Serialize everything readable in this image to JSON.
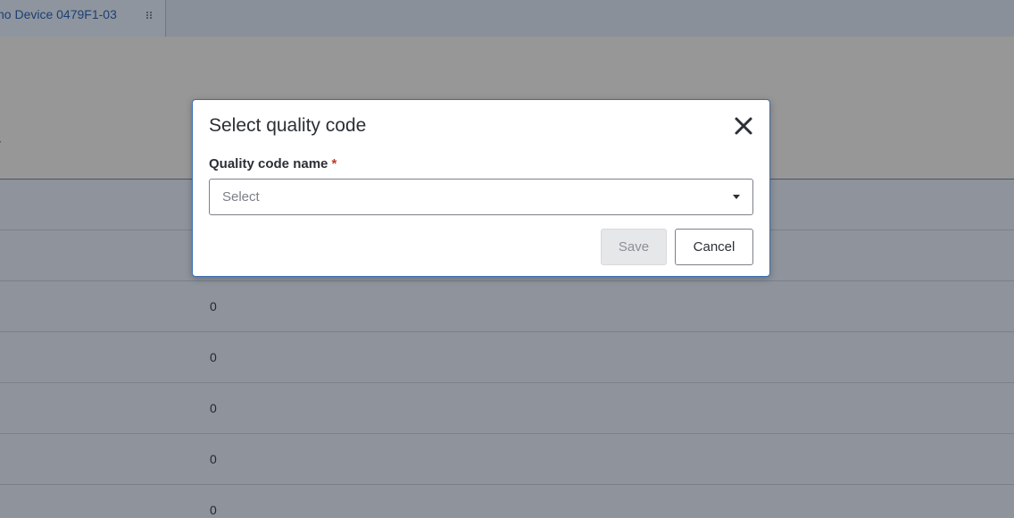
{
  "tab": {
    "label": "no Device 0479F1-03",
    "grip_icon": "drag-handle-icon"
  },
  "table": {
    "rows": [
      {
        "value": ""
      },
      {
        "value": ""
      },
      {
        "value": "0"
      },
      {
        "value": "0"
      },
      {
        "value": "0"
      },
      {
        "value": "0"
      },
      {
        "value": "0"
      }
    ]
  },
  "modal": {
    "title": "Select quality code",
    "close_icon": "close-icon",
    "field_label": "Quality code name",
    "required_mark": "*",
    "select_placeholder": "Select",
    "save_label": "Save",
    "cancel_label": "Cancel"
  },
  "colors": {
    "modal_border": "#3a6fb7",
    "tab_text": "#1d3f73",
    "required": "#c0392b"
  }
}
